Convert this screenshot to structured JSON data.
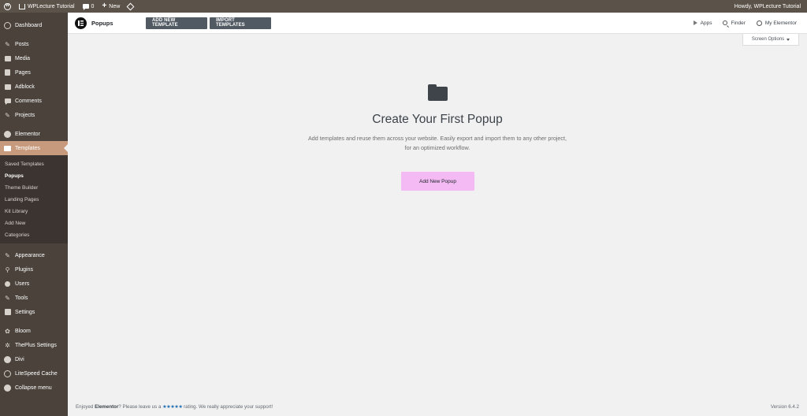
{
  "admin_bar": {
    "site_name": "WPLecture Tutorial",
    "comments_count": "0",
    "new_label": "New",
    "howdy": "Howdy, WPLecture Tutorial"
  },
  "sidebar": {
    "items_top": [
      {
        "label": "Dashboard",
        "icon": "dashboard-icon"
      }
    ],
    "items_content": [
      {
        "label": "Posts",
        "icon": "pin-icon"
      },
      {
        "label": "Media",
        "icon": "media-icon"
      },
      {
        "label": "Pages",
        "icon": "pages-icon"
      },
      {
        "label": "Adblock",
        "icon": "adblock-icon"
      },
      {
        "label": "Comments",
        "icon": "comments-icon"
      },
      {
        "label": "Projects",
        "icon": "pin-icon"
      }
    ],
    "elementor": {
      "label": "Elementor",
      "icon": "elementor-icon"
    },
    "templates": {
      "label": "Templates",
      "icon": "folder-icon"
    },
    "submenu": [
      {
        "label": "Saved Templates"
      },
      {
        "label": "Popups"
      },
      {
        "label": "Theme Builder"
      },
      {
        "label": "Landing Pages"
      },
      {
        "label": "Kit Library"
      },
      {
        "label": "Add New"
      },
      {
        "label": "Categories"
      }
    ],
    "items_settings": [
      {
        "label": "Appearance",
        "icon": "appearance-icon"
      },
      {
        "label": "Plugins",
        "icon": "plugins-icon"
      },
      {
        "label": "Users",
        "icon": "users-icon"
      },
      {
        "label": "Tools",
        "icon": "tools-icon"
      },
      {
        "label": "Settings",
        "icon": "settings-icon"
      }
    ],
    "items_plugins": [
      {
        "label": "Bloom",
        "icon": "bloom-icon"
      },
      {
        "label": "ThePlus Settings",
        "icon": "theplus-icon"
      },
      {
        "label": "Divi",
        "icon": "divi-icon"
      },
      {
        "label": "LiteSpeed Cache",
        "icon": "litespeed-icon"
      },
      {
        "label": "Collapse menu",
        "icon": "collapse-icon"
      }
    ]
  },
  "header": {
    "title": "Popups",
    "add_template": "ADD NEW TEMPLATE",
    "import_templates": "IMPORT TEMPLATES",
    "apps": "Apps",
    "finder": "Finder",
    "my_elementor": "My Elementor"
  },
  "screen_options": "Screen Options",
  "main": {
    "headline": "Create Your First Popup",
    "description": "Add templates and reuse them across your website. Easily export and import them to any other project, for an optimized workflow.",
    "cta": "Add New Popup"
  },
  "footer": {
    "enjoyed": "Enjoyed",
    "brand": "Elementor",
    "middle": "? Please leave us a",
    "stars": "★★★★★",
    "end": "rating. We really appreciate your support!",
    "version": "Version 6.4.2"
  }
}
